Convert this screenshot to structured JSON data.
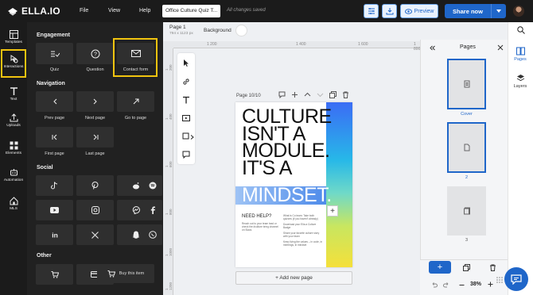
{
  "app": {
    "brand": "ELLA.IO",
    "menu": [
      "File",
      "View",
      "Help"
    ],
    "doc_title": "Office Culture Quiz T...",
    "save_status": "All changes saved",
    "preview_label": "Preview",
    "share_label": "Share now"
  },
  "rail": [
    {
      "label": "Templates"
    },
    {
      "label": "Interactions"
    },
    {
      "label": "Text"
    },
    {
      "label": "Uploads"
    },
    {
      "label": "Elements"
    },
    {
      "label": "Automation"
    },
    {
      "label": "MLS"
    }
  ],
  "panel": {
    "engagement_title": "Engagement",
    "engagement": [
      {
        "label": "Quiz"
      },
      {
        "label": "Question"
      },
      {
        "label": "Contact form"
      }
    ],
    "navigation_title": "Navigation",
    "navigation": [
      {
        "label": "Prev page"
      },
      {
        "label": "Next page"
      },
      {
        "label": "Go to page"
      },
      {
        "label": "First page"
      },
      {
        "label": "Last page"
      }
    ],
    "social_title": "Social",
    "social": [
      "tiktok",
      "pinterest",
      "reddit",
      "spotify",
      "youtube",
      "instagram",
      "messenger",
      "facebook",
      "linkedin",
      "x",
      "snapchat",
      "whatsapp"
    ],
    "other_title": "Other",
    "buy_label": "Buy this item"
  },
  "canvas": {
    "page_name": "Page 1",
    "page_size": "794 x 1123 px",
    "background_label": "Background",
    "ruler_top": [
      "1 200",
      "1 400",
      "1 600",
      "1 800"
    ],
    "ruler_left": [
      "1 200",
      "1 400",
      "1 600",
      "1 800",
      "1 1000",
      "1 1200"
    ],
    "page_counter": "Page 10/10",
    "add_page": "+ Add new page"
  },
  "design": {
    "headline": [
      "CULTURE",
      "ISN'T A",
      "MODULE.",
      "IT'S A"
    ],
    "mindset": "MINDSET.",
    "need_help": "NEED HELP?",
    "left_small": "Reach out to your team lead or check the #culture bring channel on Slack.",
    "right_small": [
      "What is Co team: Take both quizzes (if you haven't already)",
      "Download your Ella a Culture Badge",
      "Share your favorite culture story with your team",
      "Keep living the values – in code, in meetings, in mindset"
    ]
  },
  "pages_panel": {
    "title": "Pages",
    "thumbs": [
      {
        "label": "Cover"
      },
      {
        "label": "2"
      },
      {
        "label": "3"
      }
    ],
    "zoom": "38%"
  },
  "right_rail": [
    {
      "label": "Pages"
    },
    {
      "label": "Layers"
    }
  ],
  "colors": {
    "accent": "#1f66c9",
    "highlight": "#f1c40f",
    "dark": "#1b1b1b"
  }
}
